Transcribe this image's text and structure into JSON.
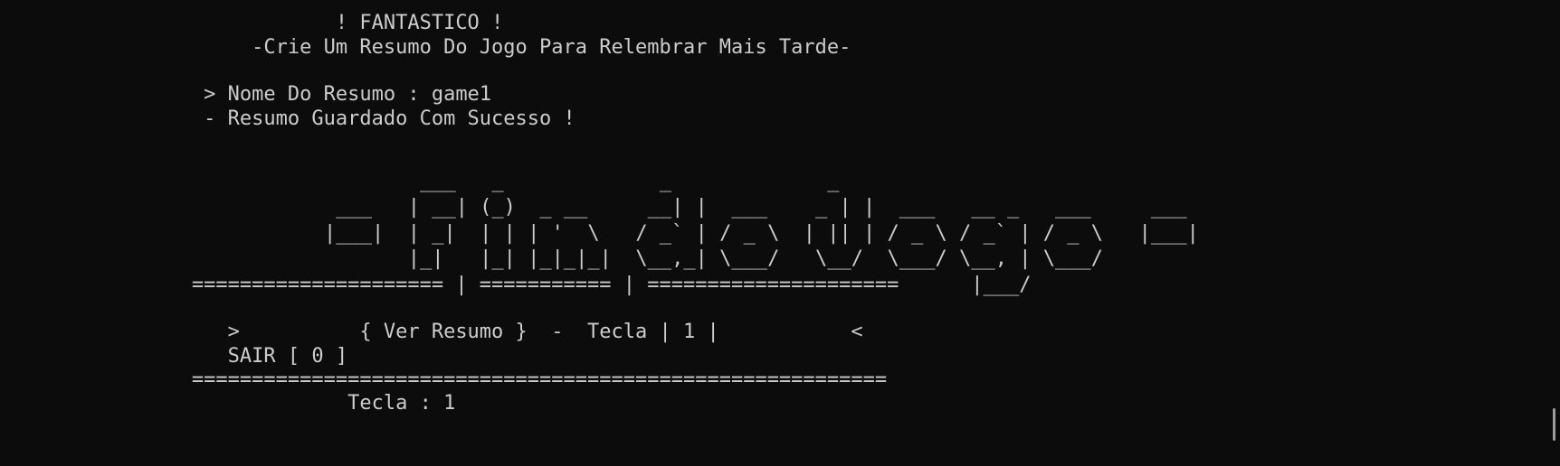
{
  "terminal": {
    "colors": {
      "background": "#0c0c0c",
      "foreground": "#cccccc",
      "scrollbar": "#9d9d9d"
    },
    "lines": {
      "title": "                            ! FANTASTICO !",
      "subtitle": "                     -Crie Um Resumo Do Jogo Para Relembrar Mais Tarde-",
      "name_prompt": "                 > Nome Do Resumo : game1",
      "saved_message": "                 - Resumo Guardado Com Sucesso !",
      "separator_top": "                ===================== | =========== | =====================",
      "menu_option_1": "                   >          { Ver Resumo }  -  Tecla | 1 |           <",
      "menu_option_exit": "                   SAIR [ 0 ]",
      "separator_bottom": "                ==========================================================",
      "input_echo": "                             Tecla : 1"
    },
    "ascii_banner": "        ___   _             _             _\n ___   | __| (_)  _ __     __| |  ___    _ | |  ___   __ _   ___     ___\n|___|  | _|  | | | '  \\   / _` | / _ \\  | || | / _ \\ / _` | / _ \\   |___|\n       |_|   |_| |_|_|_|  \\__,_| \\___/   \\__/  \\___/ \\__, | \\___/\n                                                      |___/"
  }
}
